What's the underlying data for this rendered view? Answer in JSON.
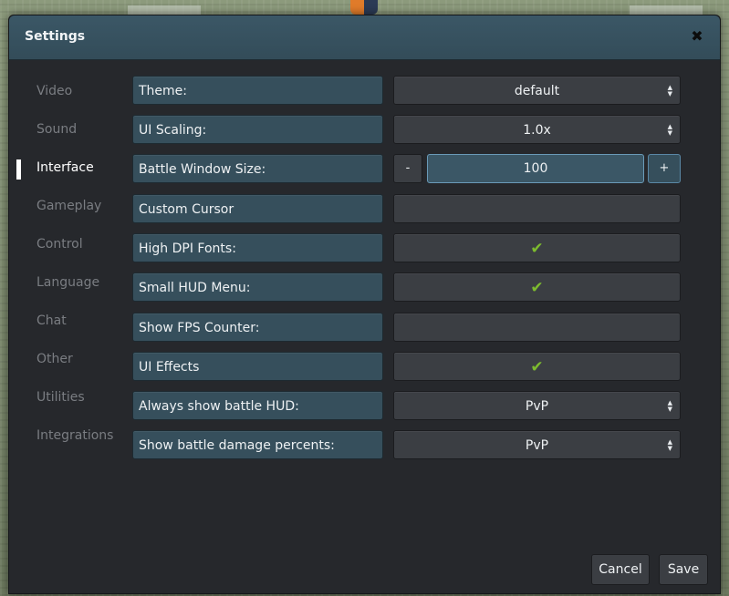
{
  "window": {
    "title": "Settings",
    "close_glyph": "✖"
  },
  "sidebar": {
    "items": [
      {
        "label": "Video",
        "active": false
      },
      {
        "label": "Sound",
        "active": false
      },
      {
        "label": "Interface",
        "active": true
      },
      {
        "label": "Gameplay",
        "active": false
      },
      {
        "label": "Control",
        "active": false
      },
      {
        "label": "Language",
        "active": false
      },
      {
        "label": "Chat",
        "active": false
      },
      {
        "label": "Other",
        "active": false
      },
      {
        "label": "Utilities",
        "active": false
      },
      {
        "label": "Integrations",
        "active": false
      }
    ]
  },
  "settings": {
    "theme": {
      "label": "Theme:",
      "value": "default"
    },
    "ui_scaling": {
      "label": "UI Scaling:",
      "value": "1.0x"
    },
    "battle_window_size": {
      "label": "Battle Window Size:",
      "value": "100",
      "minus": "-",
      "plus": "+"
    },
    "custom_cursor": {
      "label": "Custom Cursor",
      "checked": false
    },
    "high_dpi_fonts": {
      "label": "High DPI Fonts:",
      "checked": true
    },
    "small_hud_menu": {
      "label": "Small HUD Menu:",
      "checked": true
    },
    "show_fps_counter": {
      "label": "Show FPS Counter:",
      "checked": false
    },
    "ui_effects": {
      "label": "UI Effects",
      "checked": true
    },
    "always_show_battle_hud": {
      "label": "Always show battle HUD:",
      "value": "PvP"
    },
    "show_battle_damage_percents": {
      "label": "Show battle damage percents:",
      "value": "PvP"
    }
  },
  "glyphs": {
    "check": "✔",
    "select_arrows": "▲▼"
  },
  "footer": {
    "cancel_label": "Cancel",
    "save_label": "Save"
  },
  "colors": {
    "accent": "#364f5c",
    "check": "#7dbb2e",
    "panel": "#26282c"
  }
}
